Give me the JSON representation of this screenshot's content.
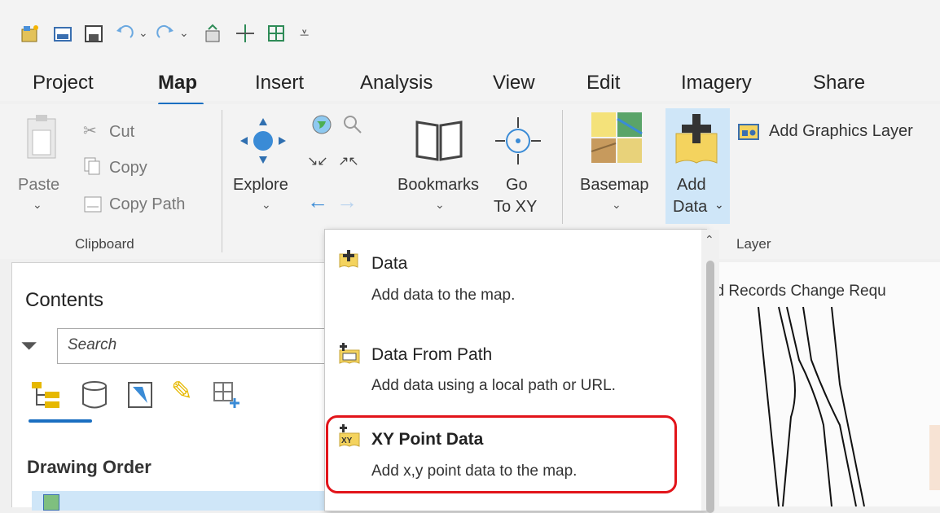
{
  "tabs": [
    {
      "label": "Project"
    },
    {
      "label": "Map"
    },
    {
      "label": "Insert"
    },
    {
      "label": "Analysis"
    },
    {
      "label": "View"
    },
    {
      "label": "Edit"
    },
    {
      "label": "Imagery"
    },
    {
      "label": "Share"
    }
  ],
  "active_tab": "Map",
  "clipboard": {
    "paste": "Paste",
    "cut": "Cut",
    "copy": "Copy",
    "copy_path": "Copy Path",
    "group": "Clipboard"
  },
  "navigate": {
    "explore": "Explore",
    "bookmarks": "Bookmarks",
    "goto_line1": "Go",
    "goto_line2": "To XY"
  },
  "layer": {
    "basemap": "Basemap",
    "add_data_line1": "Add",
    "add_data_line2": "Data",
    "add_graphics": "Add Graphics Layer",
    "group": "Layer"
  },
  "contents": {
    "title": "Contents",
    "search_placeholder": "Search",
    "drawing_order": "Drawing Order"
  },
  "map": {
    "tab_label": "nd Records Change Requ"
  },
  "dropdown": {
    "items": [
      {
        "title": "Data",
        "desc": "Add data to the map."
      },
      {
        "title": "Data From Path",
        "desc": "Add data using a local path or URL."
      },
      {
        "title": "XY Point Data",
        "desc": "Add x,y point data to the map."
      }
    ]
  },
  "colors": {
    "accent": "#1a6fc1",
    "highlight_border": "#e2141a",
    "add_data_hover": "#cfe6f8"
  }
}
